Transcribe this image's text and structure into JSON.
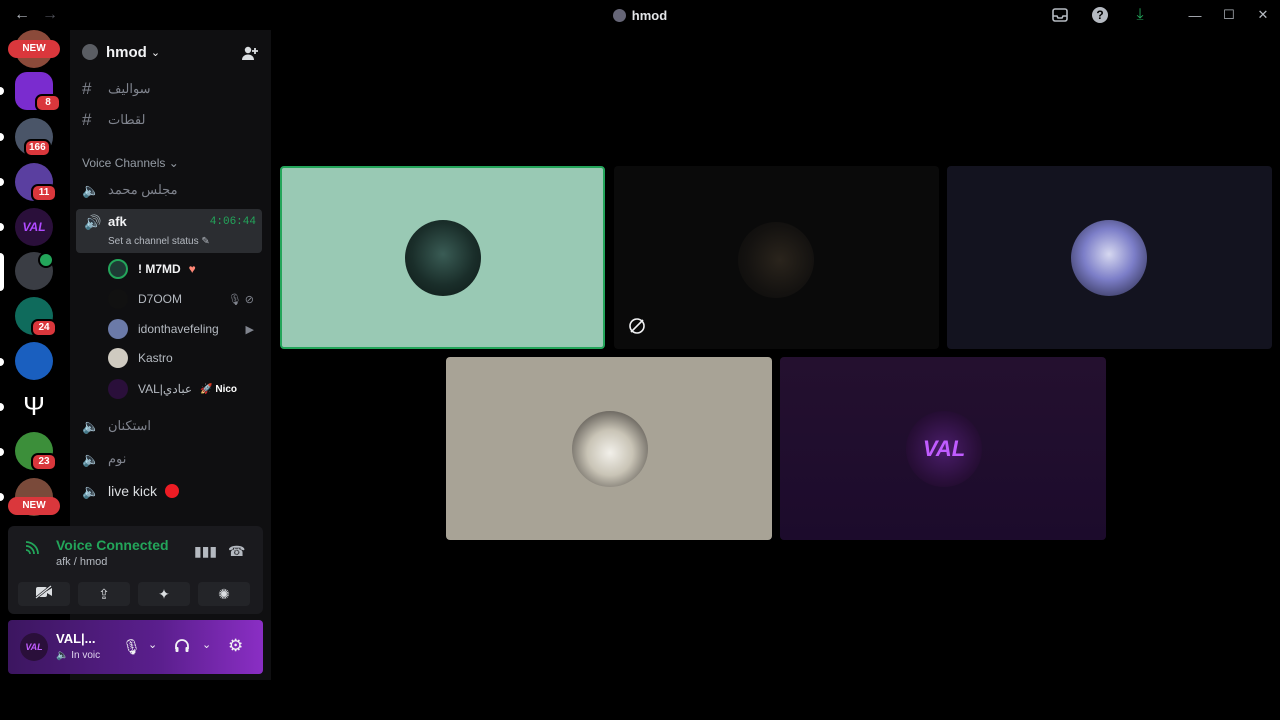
{
  "window": {
    "title": "hmod",
    "back_icon": "←",
    "forward_icon": "→",
    "inbox_icon": "inbox-icon",
    "help_icon": "?",
    "download_icon": "⤓",
    "minimize": "—",
    "maximize": "☐",
    "close": "✕"
  },
  "servers": {
    "new_top": "NEW",
    "new_bottom": "NEW",
    "badges": [
      "8",
      "166",
      "11",
      "24",
      "23"
    ]
  },
  "guild": {
    "name": "hmod",
    "caret": "⌄"
  },
  "text_channels": [
    {
      "name": "سواليف"
    },
    {
      "name": "لقطات"
    }
  ],
  "voice_category": "Voice Channels",
  "voice_channels": {
    "majlis": "مجلس محمد",
    "afk": {
      "name": "afk",
      "timer": "4:06:44",
      "status": "Set a channel status"
    },
    "astikhan": "استكنان",
    "noum": "نوم",
    "live": "live kick"
  },
  "voice_users": [
    {
      "name": "! M7MD",
      "extra": "♥"
    },
    {
      "name": "D7OOM",
      "extra": "🎙 ⊘"
    },
    {
      "name": "idonthavefeling",
      "extra": "▶"
    },
    {
      "name": "Kastro",
      "extra": ""
    },
    {
      "name": "VAL|عبادي",
      "extra": "Nico"
    }
  ],
  "voice_panel": {
    "title": "Voice Connected",
    "subtitle": "afk / hmod"
  },
  "user_panel": {
    "name": "VAL|...",
    "status": "In voic",
    "avatar_text": "VAL"
  },
  "tiles": {
    "val_text": "VAL"
  },
  "colors": {
    "accent_green": "#23a55a",
    "tile1_bg": "#99c9b4",
    "tile3_bg": "#13131f",
    "tile4_bg": "#a8a396",
    "tile5_bg": "#1c0b2c"
  }
}
